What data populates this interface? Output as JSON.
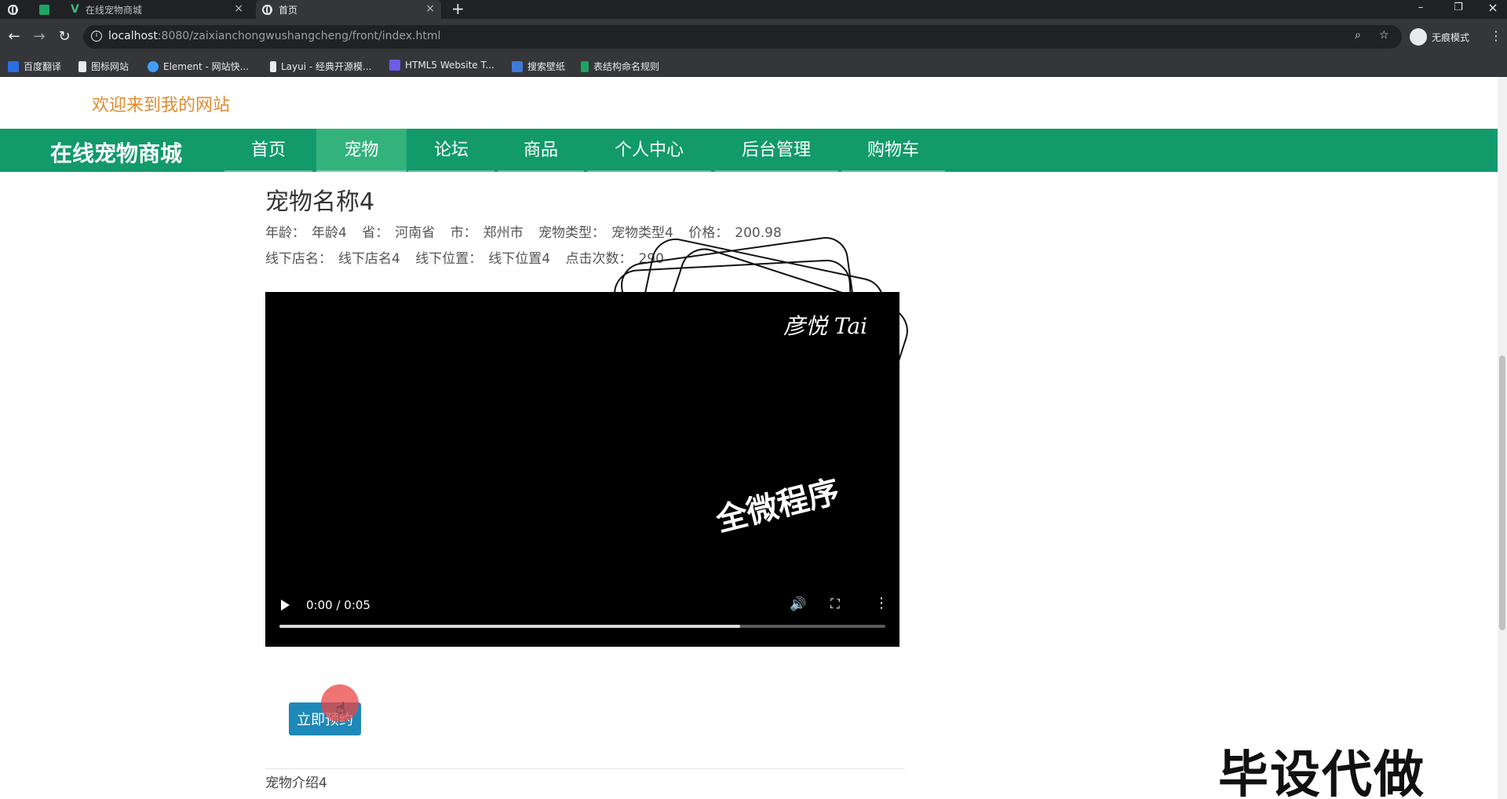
{
  "browser": {
    "tabs": [
      {
        "title": ""
      },
      {
        "title": ""
      },
      {
        "title": "在线宠物商城"
      },
      {
        "title": "首页"
      }
    ],
    "url_host": "localhost",
    "url_path": ":8080/zaixianchongwushangcheng/front/index.html",
    "incognito_label": "无痕模式",
    "bookmarks": [
      {
        "label": "百度翻译",
        "icon": "baidu-translate-icon",
        "color": "#2b6de3"
      },
      {
        "label": "图标网站",
        "icon": "flag-icon",
        "color": "#e8eaed"
      },
      {
        "label": "Element - 网站快...",
        "icon": "element-icon",
        "color": "#409eff"
      },
      {
        "label": "Layui - 经典开源模...",
        "icon": "layui-icon",
        "color": "#e8eaed"
      },
      {
        "label": "HTML5 Website T...",
        "icon": "html5-icon",
        "color": "#6c5ce7"
      },
      {
        "label": "搜索壁纸",
        "icon": "wallpaper-icon",
        "color": "#3d7bd9"
      },
      {
        "label": "表结构命名规则",
        "icon": "sheet-icon",
        "color": "#1da462"
      }
    ]
  },
  "site": {
    "welcome": "欢迎来到我的网站",
    "brand": "在线宠物商城",
    "nav": [
      {
        "label": "首页",
        "active": false
      },
      {
        "label": "宠物",
        "active": true
      },
      {
        "label": "论坛",
        "active": false
      },
      {
        "label": "商品",
        "active": false
      },
      {
        "label": "个人中心",
        "active": false
      },
      {
        "label": "后台管理",
        "active": false
      },
      {
        "label": "购物车",
        "active": false
      }
    ],
    "colors": {
      "nav_bg": "#129a6b",
      "nav_active": "#34b27c",
      "welcome": "#e08b2f",
      "button": "#1e88b8"
    }
  },
  "pet": {
    "name": "宠物名称4",
    "age_label": "年龄：",
    "age": "年龄4",
    "province_label": "省：",
    "province": "河南省",
    "city_label": "市：",
    "city": "郑州市",
    "type_label": "宠物类型：",
    "type": "宠物类型4",
    "price_label": "价格：",
    "price": "200.98",
    "store_label": "线下店名：",
    "store": "线下店名4",
    "location_label": "线下位置：",
    "location": "线下位置4",
    "clicks_label": "点击次数：",
    "clicks": "290",
    "buy_button": "立即预约",
    "intro": "宠物介绍4"
  },
  "video": {
    "time": "0:00 / 0:05",
    "progress": 0.76,
    "watermark_top": "彦悦 Tai",
    "watermark_mid": "全微程序"
  },
  "overlay_watermark": "毕设代做"
}
